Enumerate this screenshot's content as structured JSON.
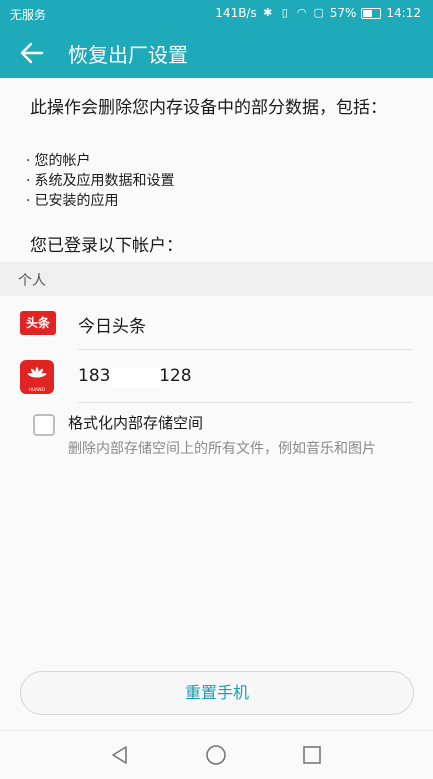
{
  "status_bar": {
    "carrier": "无服务",
    "net_speed": "141B/s",
    "battery": "57%",
    "battery_level": 0.57,
    "time": "14:12"
  },
  "app_bar": {
    "title": "恢复出厂设置",
    "back_icon": "arrow-left-icon"
  },
  "warning_text": "此操作会删除您内存设备中的部分数据，包括：",
  "bullets": [
    "您的帐户",
    "系统及应用数据和设置",
    "已安装的应用"
  ],
  "accounts_heading": "您已登录以下帐户：",
  "section_label": "个人",
  "accounts": [
    {
      "logo_text": "头条",
      "name": "今日头条"
    },
    {
      "logo_text": "HUAWEI",
      "name": "183       3128"
    }
  ],
  "format_option": {
    "title": "格式化内部存储空间",
    "description": "删除内部存储空间上的所有文件，例如音乐和图片",
    "checked": false
  },
  "reset_button": "重置手机",
  "colors": {
    "accent": "#1eaab9",
    "button_text": "#1a9fae",
    "logo_red": "#e02424"
  }
}
